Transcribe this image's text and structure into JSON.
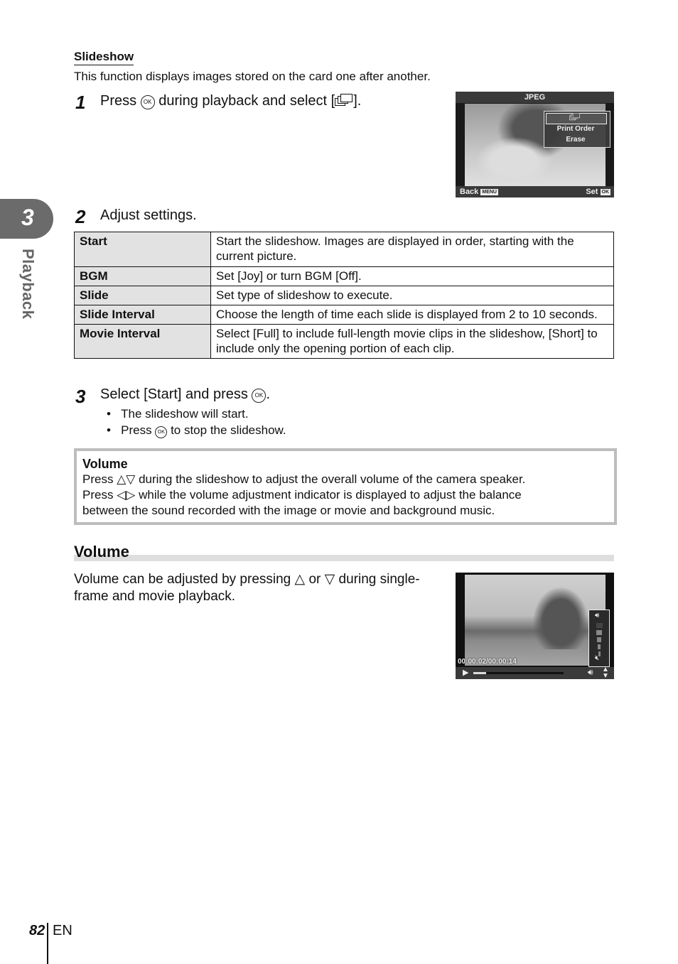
{
  "chapter": {
    "number": "3",
    "label": "Playback"
  },
  "section": {
    "title": "Slideshow",
    "intro": "This function displays images stored on the card one after another."
  },
  "steps": [
    {
      "num": "1",
      "before": "Press",
      "button": "OK",
      "after": "during playback and select [",
      "icon": "slideshow-icon",
      "end": "]."
    },
    {
      "num": "2",
      "text": "Adjust settings."
    },
    {
      "num": "3",
      "before": "Select [Start] and press",
      "button": "OK",
      "end": "."
    }
  ],
  "camera_screen_1": {
    "title": "JPEG",
    "menu_items": [
      "slideshow-icon",
      "Print Order",
      "Erase"
    ],
    "selected_index": 0,
    "back_label": "Back",
    "back_button": "MENU",
    "set_label": "Set",
    "set_button": "OK"
  },
  "settings_table": {
    "rows": [
      {
        "key": "Start",
        "value": "Start the slideshow. Images are displayed in order, starting with the current picture."
      },
      {
        "key": "BGM",
        "value": "Set [Joy] or turn BGM [Off]."
      },
      {
        "key": "Slide",
        "value": "Set type of slideshow to execute."
      },
      {
        "key": "Slide Interval",
        "value": "Choose the length of time each slide is displayed from 2 to 10 seconds."
      },
      {
        "key": "Movie Interval",
        "value": "Select [Full] to include full-length movie clips in the slideshow, [Short] to include only the opening portion of each clip."
      }
    ]
  },
  "step3_bullets": [
    {
      "text": "The slideshow will start."
    },
    {
      "before": "Press",
      "button": "OK",
      "after": "to stop the slideshow."
    }
  ],
  "note": {
    "title": "Volume",
    "line1_before": "Press",
    "line1_arrows": "△▽",
    "line1_after": "during the slideshow to adjust the overall volume of the camera speaker.",
    "line2_before": "Press",
    "line2_arrows": "◁▷",
    "line2_after": "while the volume adjustment indicator is displayed to adjust the balance",
    "line3": "between the sound recorded with the image or movie and background music."
  },
  "volume_section": {
    "title": "Volume",
    "text_before": "Volume can be adjusted by pressing",
    "up": "△",
    "or": "or",
    "down": "▽",
    "text_after": "during single-frame and movie playback."
  },
  "camera_screen_2": {
    "timecode": "00:00:02/00:00:14",
    "progress": 0.14,
    "volume_level": 4,
    "volume_max": 5
  },
  "footer": {
    "page": "82",
    "lang": "EN"
  }
}
